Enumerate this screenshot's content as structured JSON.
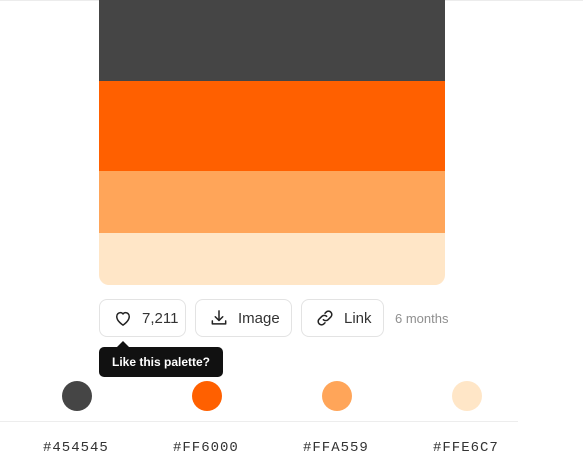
{
  "palette": {
    "colors": [
      {
        "hex": "#454545",
        "label": "#454545"
      },
      {
        "hex": "#FF6000",
        "label": "#FF6000"
      },
      {
        "hex": "#FFA559",
        "label": "#FFA559"
      },
      {
        "hex": "#FFE6C7",
        "label": "#FFE6C7"
      }
    ]
  },
  "actions": {
    "likes": "7,211",
    "image_label": "Image",
    "link_label": "Link",
    "age": "6 months"
  },
  "tooltip": {
    "text": "Like this palette?"
  },
  "icons": {
    "like": "heart-icon",
    "image": "download-icon",
    "link": "link-icon"
  }
}
